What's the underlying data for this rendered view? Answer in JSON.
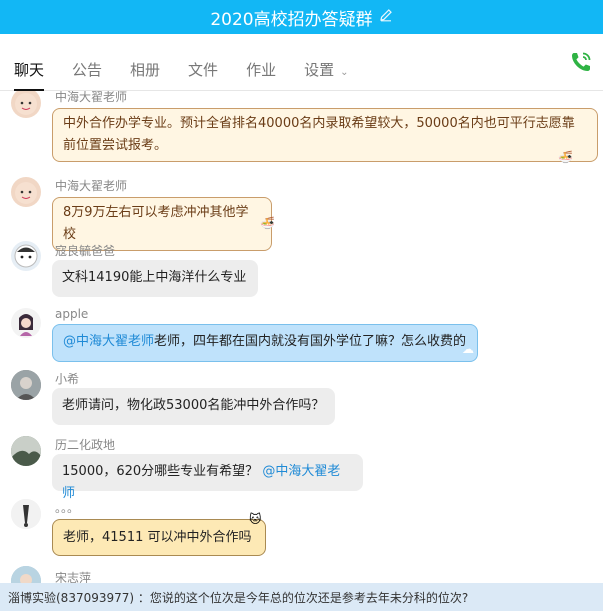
{
  "header": {
    "title": "2020高校招办答疑群",
    "edit_icon": "pencil-icon"
  },
  "tabs": [
    {
      "label": "聊天"
    },
    {
      "label": "公告"
    },
    {
      "label": "相册"
    },
    {
      "label": "文件"
    },
    {
      "label": "作业"
    },
    {
      "label": "设置"
    }
  ],
  "colors": {
    "titlebar": "#12b7f5",
    "mention": "#1f8ad6",
    "phone": "#2fb344"
  },
  "messages": [
    {
      "sender": "中海大翟老师",
      "text": "中外合作办学专业。预计全省排名40000名内录取希望较大，50000名内也可平行志愿靠前位置尝试报考。"
    },
    {
      "sender": "中海大翟老师",
      "text": "8万9万左右可以考虑冲冲其他学校"
    },
    {
      "sender": "寇良毓爸爸",
      "text": "文科14190能上中海洋什么专业"
    },
    {
      "sender": "apple",
      "mention": "@中海大翟老师",
      "text": "老师，四年都在国内就没有国外学位了嘛？怎么收费的"
    },
    {
      "sender": "小希",
      "text": "老师请问，物化政53000名能冲中外合作吗？"
    },
    {
      "sender": "历二化政地",
      "text": "15000，620分哪些专业有希望？",
      "mention": "@中海大翟老师"
    },
    {
      "sender": "。。。",
      "text": "老师，41511  可以冲中外合作吗"
    },
    {
      "sender": "宋志萍"
    }
  ],
  "footer": {
    "text": "淄博实验(837093977) ：您说的这个位次是今年总的位次还是参考去年未分科的位次?"
  }
}
